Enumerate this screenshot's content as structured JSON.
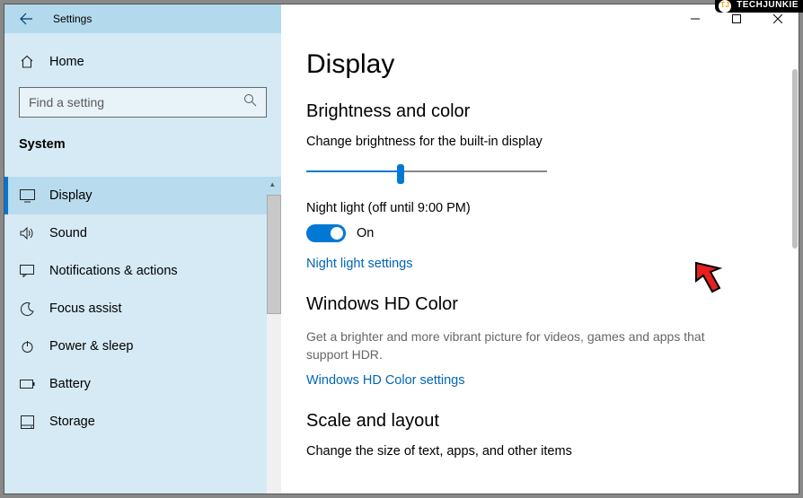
{
  "titlebar": {
    "app": "Settings"
  },
  "sidebar": {
    "home": "Home",
    "search_placeholder": "Find a setting",
    "category": "System",
    "items": [
      {
        "label": "Display",
        "active": true,
        "icon": "monitor"
      },
      {
        "label": "Sound",
        "active": false,
        "icon": "sound"
      },
      {
        "label": "Notifications & actions",
        "active": false,
        "icon": "message"
      },
      {
        "label": "Focus assist",
        "active": false,
        "icon": "moon"
      },
      {
        "label": "Power & sleep",
        "active": false,
        "icon": "power"
      },
      {
        "label": "Battery",
        "active": false,
        "icon": "battery"
      },
      {
        "label": "Storage",
        "active": false,
        "icon": "storage"
      }
    ]
  },
  "main": {
    "title": "Display",
    "brightness": {
      "heading": "Brightness and color",
      "slider_label": "Change brightness for the built-in display",
      "slider_value_pct": 39,
      "night_light_label": "Night light (off until 9:00 PM)",
      "toggle_state": "On",
      "link": "Night light settings"
    },
    "hdcolor": {
      "heading": "Windows HD Color",
      "desc": "Get a brighter and more vibrant picture for videos, games and apps that support HDR.",
      "link": "Windows HD Color settings"
    },
    "scale": {
      "heading": "Scale and layout",
      "desc": "Change the size of text, apps, and other items"
    }
  },
  "brand": "TECHJUNKIE"
}
